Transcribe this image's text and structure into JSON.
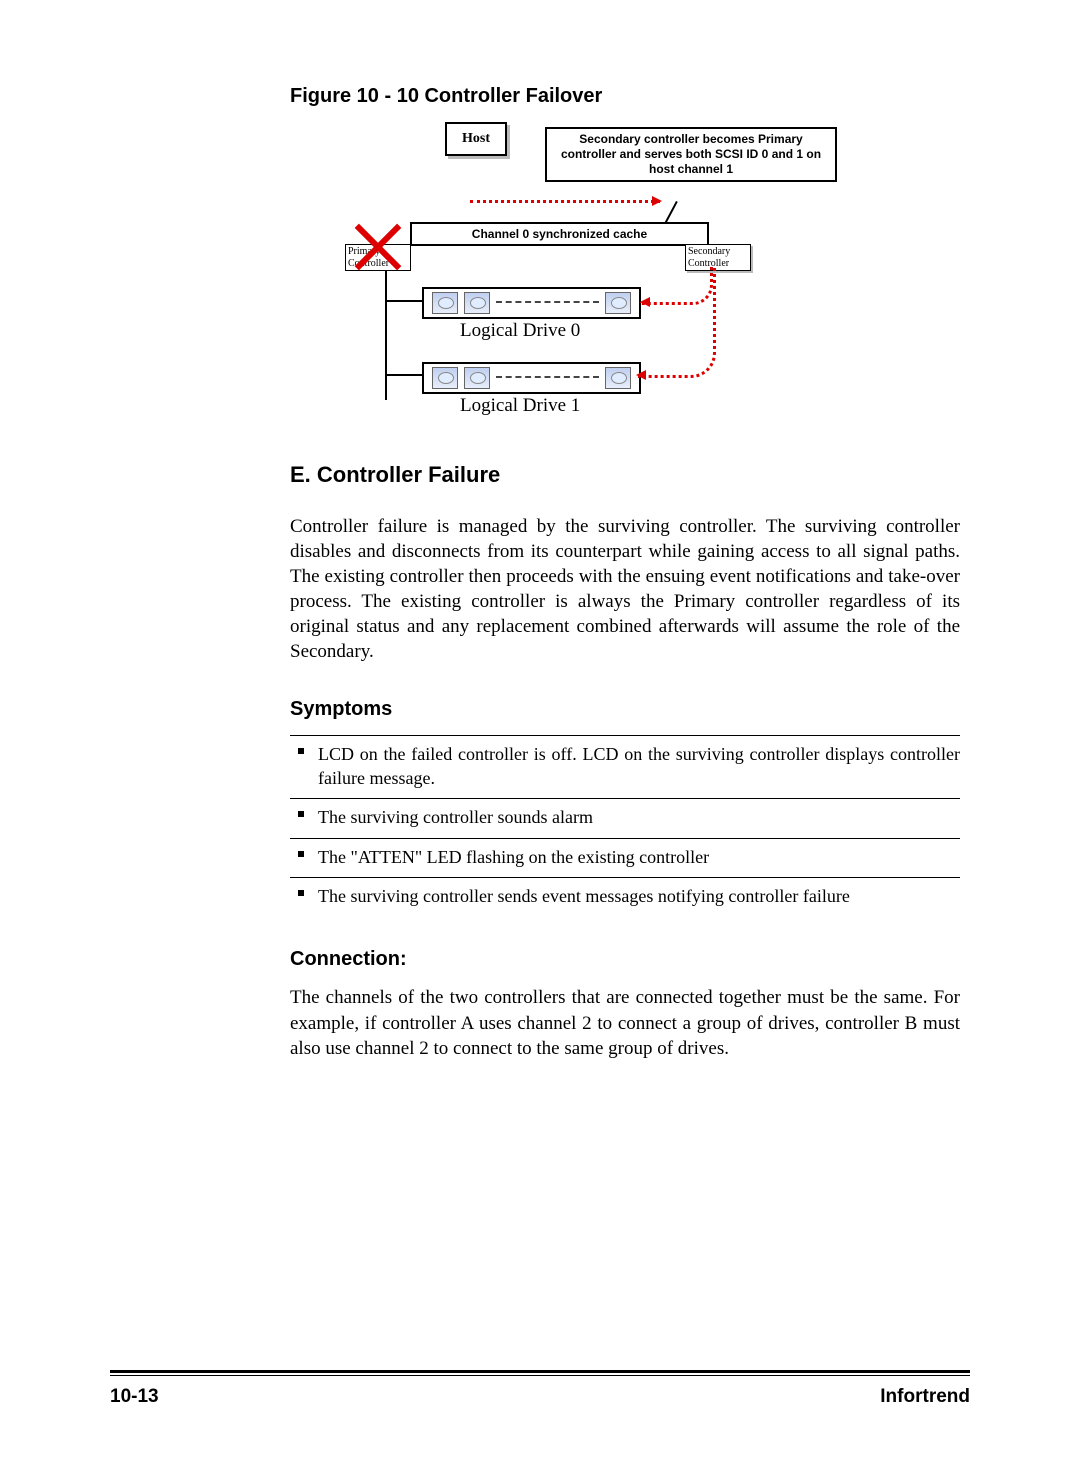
{
  "figure": {
    "title": "Figure 10 - 10    Controller Failover",
    "host_label": "Host",
    "callout": "Secondary controller becomes Primary controller and serves both SCSI ID 0 and 1 on host channel 1",
    "sync_label": "Channel 0 synchronized cache",
    "primary_label": "Primary Controller",
    "secondary_label": "Secondary Controller",
    "ld0_label": "Logical Drive 0",
    "ld1_label": "Logical Drive 1"
  },
  "section_e": {
    "heading": "E. Controller Failure",
    "paragraph": "Controller failure is managed by the surviving controller.  The surviving controller disables and disconnects from its counterpart while gaining access to all signal paths.  The existing controller then proceeds with the ensuing event notifications and take-over process.  The existing controller is always the Primary controller regardless of its original status and any replacement combined afterwards will assume the role of the Secondary."
  },
  "symptoms": {
    "heading": "Symptoms",
    "items": [
      "LCD on the failed controller is off.  LCD on the surviving controller displays controller failure message.",
      "The surviving controller sounds alarm",
      "The \"ATTEN\" LED flashing on the existing controller",
      "The surviving controller sends event messages notifying controller failure"
    ]
  },
  "connection": {
    "heading": "Connection:",
    "paragraph": "The channels of the two controllers that are connected together must be the same.  For example, if controller A uses channel 2 to connect a group of drives, controller B must also use channel 2 to connect to the same group of drives."
  },
  "footer": {
    "left": "10-13",
    "right": "Infortrend"
  }
}
